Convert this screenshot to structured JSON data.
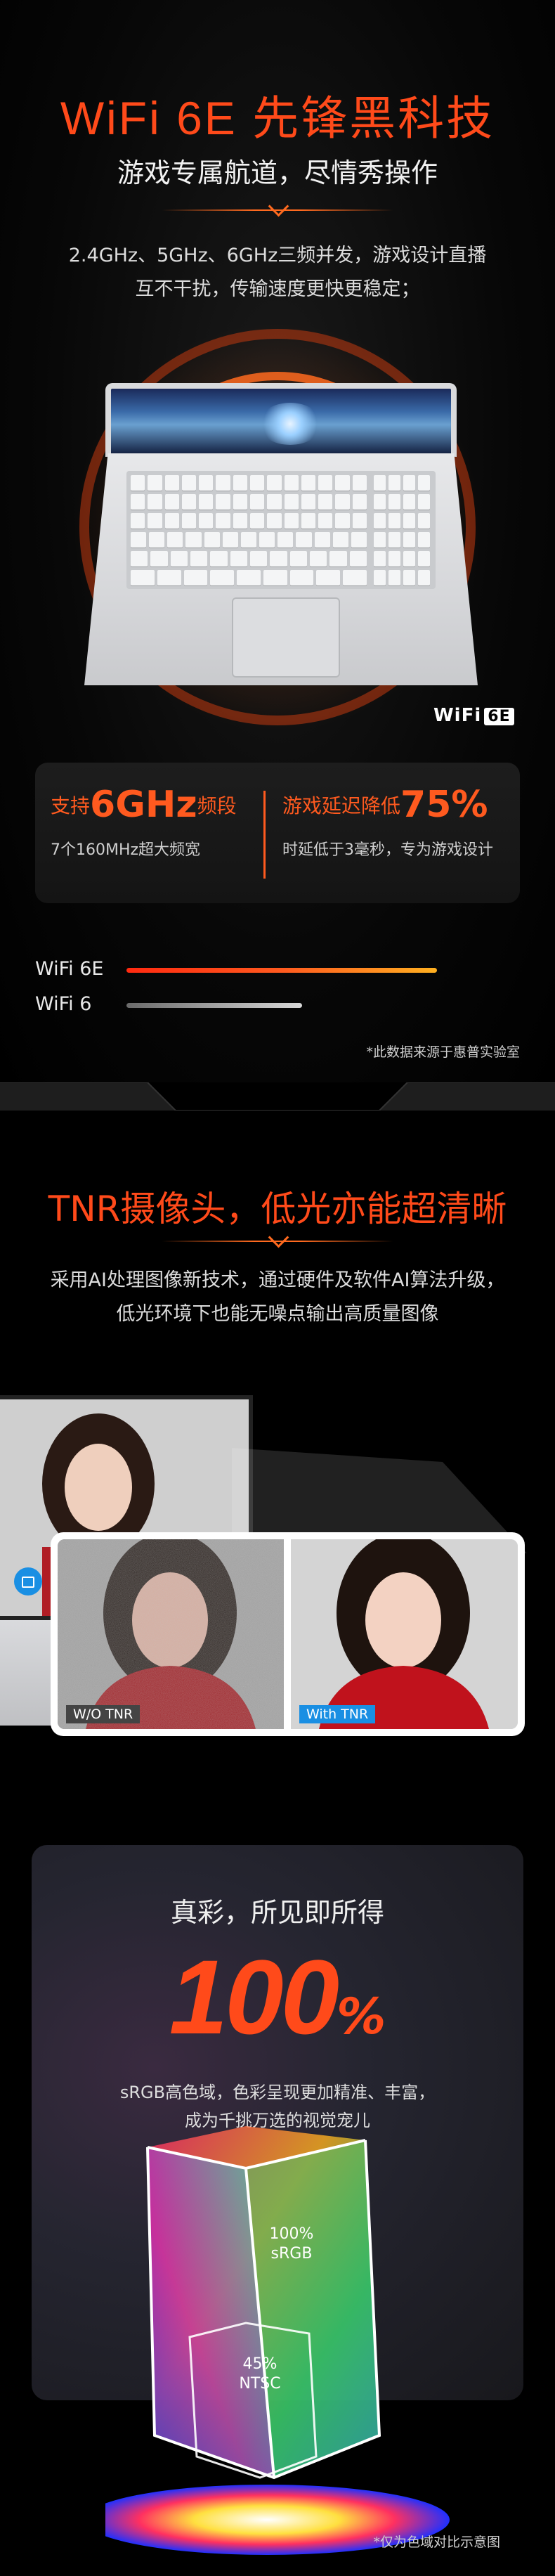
{
  "wifi": {
    "title": "WiFi 6E 先锋黑科技",
    "subtitle": "游戏专属航道，尽情秀操作",
    "desc_line1": "2.4GHz、5GHz、6GHz三频并发，游戏设计直播",
    "desc_line2": "互不干扰，传输速度更快更稳定；",
    "badge_text": "WiFi",
    "badge_box": "6E",
    "stat_left_prefix": "支持",
    "stat_left_value": "6GHz",
    "stat_left_suffix": "频段",
    "stat_left_sub": "7个160MHz超大频宽",
    "stat_right_prefix": "游戏延迟降低",
    "stat_right_value": "75%",
    "stat_right_sub": "时延低于3毫秒，专为游戏设计",
    "compare": [
      {
        "label": "WiFi 6E",
        "level": 0.92,
        "color": "#ff5a1f"
      },
      {
        "label": "WiFi 6",
        "level": 0.52,
        "color": "#9a9a9a"
      }
    ],
    "footnote": "*此数据来源于惠普实验室"
  },
  "camera": {
    "title": "TNR摄像头，低光亦能超清晰",
    "desc_line1": "采用AI处理图像新技术，通过硬件及软件AI算法升级，",
    "desc_line2": "低光环境下也能无噪点输出高质量图像",
    "tag_before": "W/O TNR",
    "tag_after": "With TNR"
  },
  "color": {
    "title": "真彩，所见即所得",
    "value": "100",
    "unit": "%",
    "desc_line1": "sRGB高色域，色彩呈现更加精准、丰富，",
    "desc_line2": "成为千挑万选的视觉宠儿",
    "label_srgb_value": "100%",
    "label_srgb_name": "sRGB",
    "label_ntsc_value": "45%",
    "label_ntsc_name": "NTSC",
    "footnote": "*仅为色域对比示意图"
  },
  "colors": {
    "accent": "#ff5a1f",
    "background": "#000000",
    "tnr_blue": "#1a8fe3"
  }
}
